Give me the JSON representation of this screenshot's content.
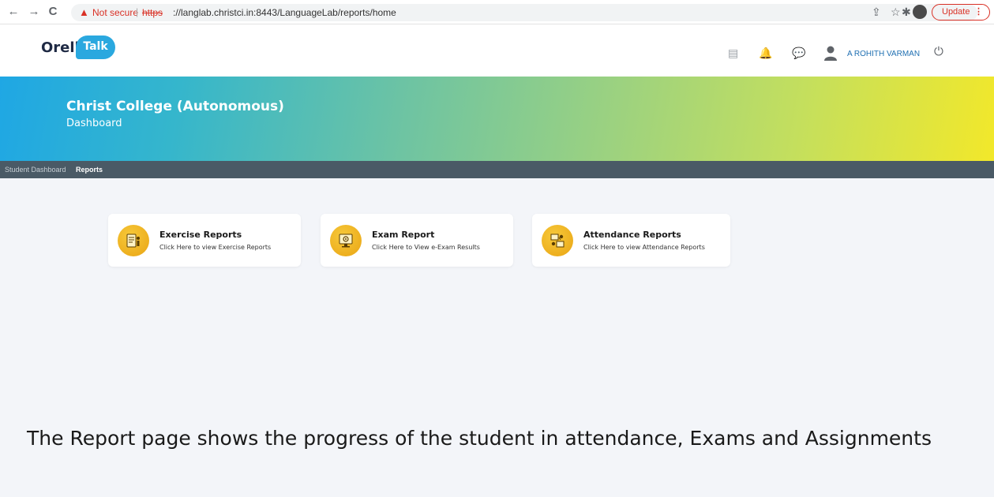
{
  "browser": {
    "not_secure": "Not secure",
    "url_scheme": "https",
    "url_rest": "://langlab.christci.in:8443/LanguageLab/reports/home",
    "url_separator": "|",
    "update_label": "Update",
    "update_menu": "⋮",
    "icons": {
      "back": "←",
      "forward": "→",
      "reload": "C",
      "warning": "▲",
      "share": "⇪",
      "star": "☆",
      "extensions": "✱"
    }
  },
  "header": {
    "logo_text": "Orell",
    "logo_bubble": "Talk",
    "user_name": "A ROHITH VARMAN",
    "icons": {
      "book": "▤",
      "bell": "🔔",
      "chat": "💬",
      "power": "⏻"
    }
  },
  "banner": {
    "college": "Christ College (Autonomous)",
    "subtitle": "Dashboard"
  },
  "nav": {
    "items": [
      {
        "label": "Student Dashboard",
        "active": false
      },
      {
        "label": "Reports",
        "active": true
      }
    ]
  },
  "cards": [
    {
      "title": "Exercise Reports",
      "desc": "Click Here to view Exercise Reports",
      "icon": "exercise-report-icon"
    },
    {
      "title": "Exam Report",
      "desc": "Click Here to View e-Exam Results",
      "icon": "exam-report-icon"
    },
    {
      "title": "Attendance Reports",
      "desc": "Click Here to view Attendance Reports",
      "icon": "attendance-report-icon"
    }
  ],
  "caption": "The Report page shows the progress of the student in attendance, Exams and Assignments",
  "colors": {
    "accent_blue": "#2aa8df",
    "nav_bg": "#4a5a66",
    "card_icon": "#f2b52a",
    "warning_red": "#d93025"
  }
}
